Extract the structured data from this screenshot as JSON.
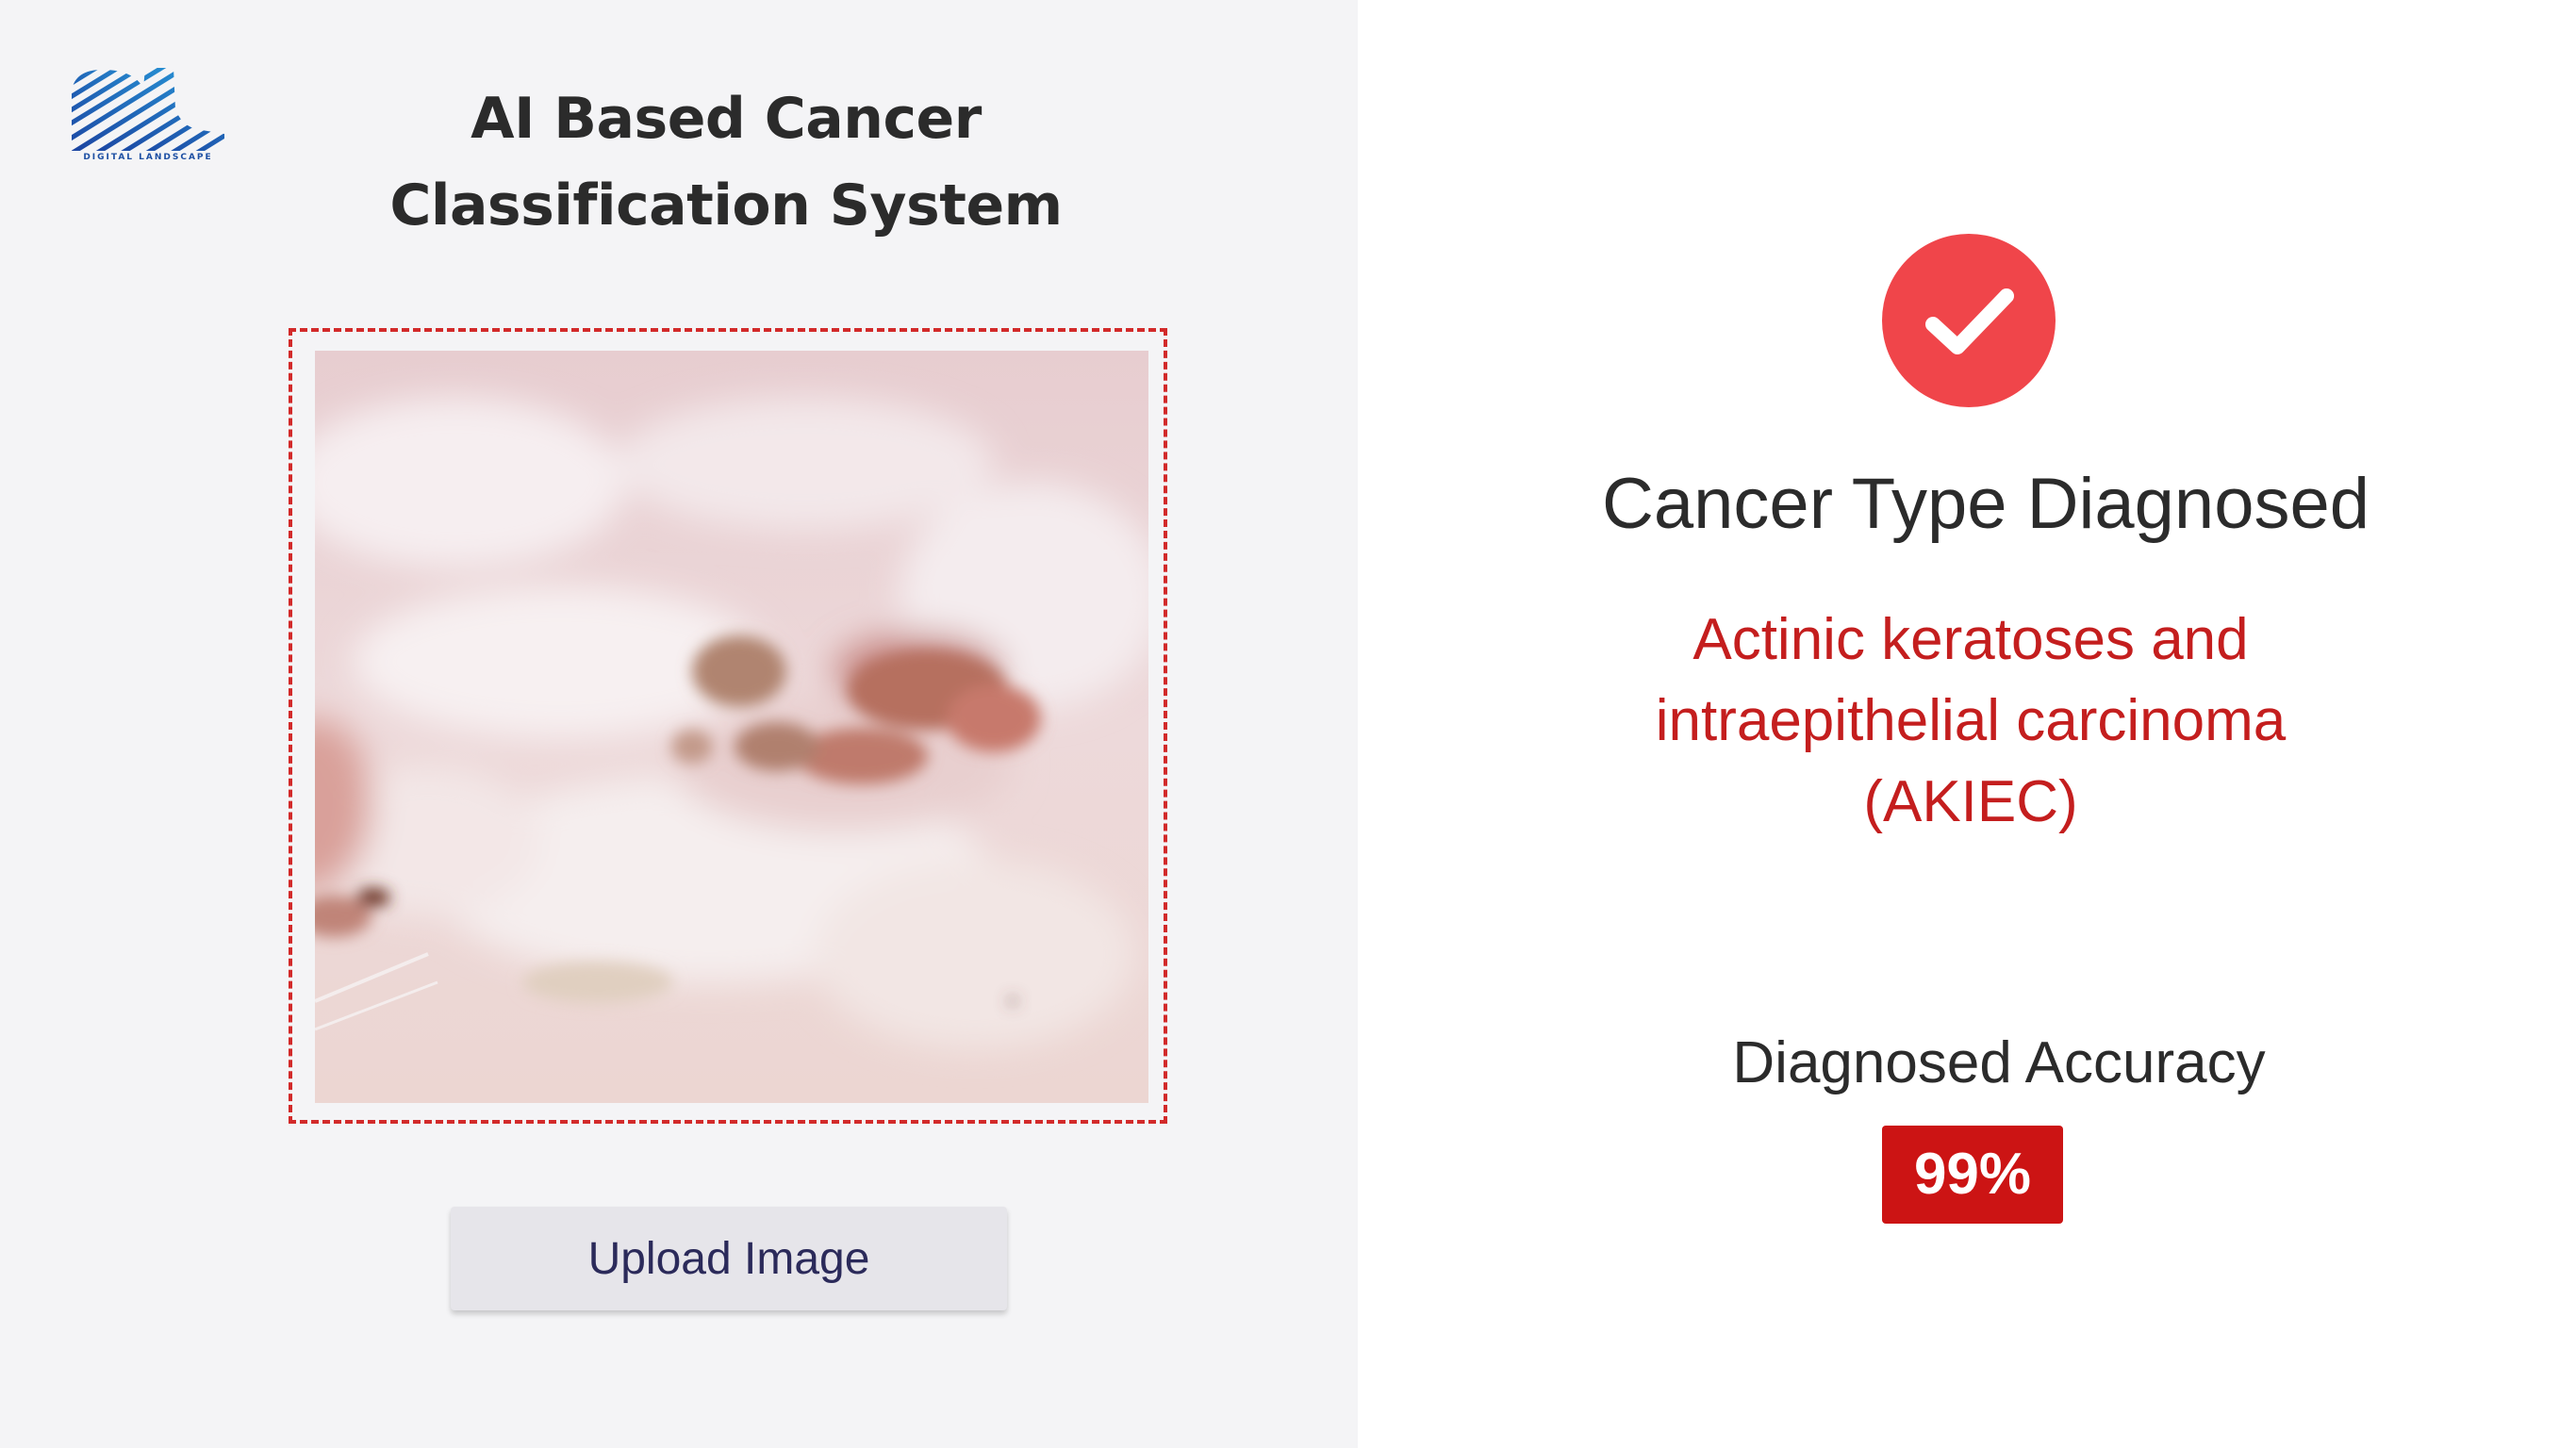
{
  "app": {
    "logo_text": "DIGITAL LANDSCAPE",
    "title_line1": "AI Based Cancer",
    "title_line2": "Classification System"
  },
  "upload": {
    "button_label": "Upload Image"
  },
  "result": {
    "status_icon": "check-icon",
    "title": "Cancer Type Diagnosed",
    "diagnosis_line1": "Actinic keratoses and",
    "diagnosis_line2": "intraepithelial carcinoma",
    "diagnosis_line3": "(AKIEC)",
    "accuracy_label": "Diagnosed Accuracy",
    "accuracy_value": "99%"
  },
  "colors": {
    "accent_red": "#d22a2a",
    "check_circle": "#f0454a",
    "diagnosis_text": "#c41e1e",
    "badge_bg": "#cc1414",
    "logo_blue": "#1d4fa3"
  }
}
